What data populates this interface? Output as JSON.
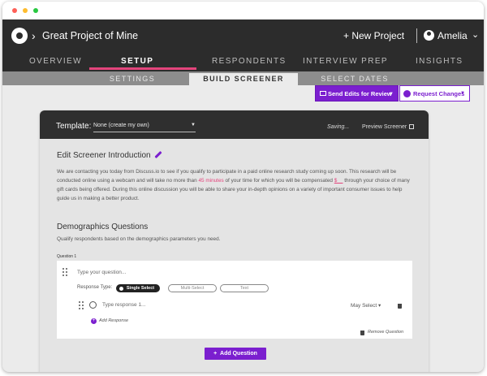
{
  "window": {
    "controls": [
      "close",
      "minimize",
      "maximize"
    ]
  },
  "header": {
    "logo": "discuss-logo-icon",
    "breadcrumb_sep": "›",
    "project_title": "Great Project of Mine",
    "new_project": "+ New Project",
    "user_name": "Amelia",
    "user_chevron": "⌄"
  },
  "main_tabs": [
    {
      "label": "OVERVIEW",
      "active": false
    },
    {
      "label": "SETUP",
      "active": true
    },
    {
      "label": "RESPONDENTS",
      "active": false
    },
    {
      "label": "INTERVIEW PREP",
      "active": false
    },
    {
      "label": "INSIGHTS",
      "active": false
    }
  ],
  "sub_tabs": [
    {
      "label": "SETTINGS",
      "active": false
    },
    {
      "label": "BUILD SCREENER",
      "active": true
    },
    {
      "label": "SELECT DATES",
      "active": false
    }
  ],
  "actions": {
    "send_edits": "Send Edits for Review",
    "request_changes": "Request Changes",
    "caret": "▼"
  },
  "template_bar": {
    "label": "Template:",
    "value": "None (create my own)",
    "caret": "▼",
    "saving": "Saving...",
    "preview": "Preview Screener"
  },
  "intro": {
    "title": "Edit Screener Introduction",
    "text_part1": "We are contacting you today from Discuss.io to see if you qualify to participate in a paid online research study coming up soon. This research will be conducted online using a webcam and will take no more than ",
    "text_minutes": "45 minutes",
    "text_part2": " of your time for which you will be compensated ",
    "text_amount": "$__",
    "text_part3": " through your choice of many gift cards being offered. During this online discussion you will be able to share your in-depth opinions on a variety of important consumer issues to help guide us in making a better product."
  },
  "demographics": {
    "title": "Demographics Questions",
    "subtitle": "Qualify respondents based on the demographics parameters you need.",
    "question_label": "Question 1",
    "question_placeholder": "Type your question...",
    "response_type_label": "Response Type:",
    "response_types": [
      {
        "label": "Single Select",
        "active": true
      },
      {
        "label": "Multi-Select",
        "active": false
      },
      {
        "label": "Text",
        "active": false
      }
    ],
    "response_placeholder": "Type response 1...",
    "may_select": "May Select",
    "may_select_caret": "▾",
    "add_response": "Add Response",
    "remove_question": "Remove Question",
    "add_question": "Add Question"
  },
  "colors": {
    "accent": "#7b1fcf",
    "highlight": "#e4447c",
    "header_bg": "#2c2c2c"
  }
}
